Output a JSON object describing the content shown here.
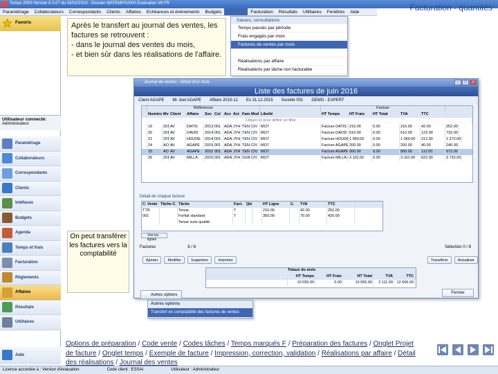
{
  "window": {
    "title": "Temps 2000 Version 8.3.07 du 03/02/2013 - Dossier MATEMPS2000 Evaluation V8 FR"
  },
  "slide_title": "Facturation - quantités",
  "menubar": [
    "Paramètrage",
    "Collaborateurs",
    "Correspondants",
    "Clients",
    "Affaires",
    "Echéances et événements",
    "Budgets",
    "",
    "Facturation",
    "Résultats",
    "Utilitaires",
    "Fenêtres",
    "Aide"
  ],
  "favorites": {
    "label": "Favoris"
  },
  "user": {
    "heading": "Utilisateur connecté:",
    "name": "Administrateur"
  },
  "nav": [
    {
      "label": "Paramètrage",
      "color": "#5b7fbf"
    },
    {
      "label": "Collaborateurs",
      "color": "#4a8ad8"
    },
    {
      "label": "Correspondants",
      "color": "#6aa0e0"
    },
    {
      "label": "Clients",
      "color": "#3c78c8"
    },
    {
      "label": "Intéfaces",
      "color": "#5a8f4a"
    },
    {
      "label": "Budgets",
      "color": "#8a5a2f"
    },
    {
      "label": "Agenda",
      "color": "#c45c3c"
    },
    {
      "label": "Temps et frais",
      "color": "#4c7fc0"
    },
    {
      "label": "Facturation",
      "color": "#7a8fb0"
    },
    {
      "label": "Règlements",
      "color": "#c08a30"
    },
    {
      "label": "Affaires",
      "color": "#d9a030",
      "active": true
    },
    {
      "label": "Résultats",
      "color": "#4f9a54"
    },
    {
      "label": "Utilitaires",
      "color": "#6e7fa0"
    }
  ],
  "bottom_nav": [
    {
      "label": "Aide",
      "color": "#3a78c8"
    },
    {
      "label": "",
      "color": "#4f9a54"
    }
  ],
  "callout1": [
    "Après le transfert au journal des ventes, les factures se retrouvent :",
    "- dans le journal des ventes du mois,",
    "- et bien sûr dans les réalisations de l'affaire."
  ],
  "dropdown": {
    "header": "Saisies, consultations",
    "items": [
      "Temps passés par période",
      "Frais engagés par mois",
      "Factures de ventes par mois",
      "",
      "Réalisations par affaire",
      "Réalisations par tâche non facturable"
    ],
    "selected_index": 2
  },
  "journal": {
    "title": "Journal de ventes - Détail d'un mois",
    "list_title": "Liste des factures de juin 2016",
    "filters": [
      "Client AGAPE",
      "Mr Joel AGAPE",
      "Affaire 2015-12",
      "Ex 31.12.2015",
      "Société 001",
      "DEMO - EXPERT"
    ],
    "group_headers": [
      "",
      "Références",
      "",
      "Facture"
    ],
    "columns": [
      "",
      "Numéro",
      "Mvt",
      "Client",
      "Affaire",
      "Soc",
      "Col",
      "Acc",
      "Act",
      "Fam",
      "Mod",
      "Libellé",
      "HT Temps",
      "HT Frais",
      "HT Total",
      "TVA",
      "TTC"
    ],
    "filter_hint": "Cliquer ici pour définir un filtre",
    "rows": [
      [
        "19",
        "2016003",
        "AV",
        "DATIS",
        "2013-12",
        "001",
        "ADA",
        "JYH",
        "TEN",
        "CIV",
        "MO7",
        "Facture DATIS du 15/03/2016",
        "215.00",
        "0.00",
        "210.00",
        "42.00",
        "252.00"
      ],
      [
        "20",
        "2016005",
        "AV",
        "DAVID",
        "2014-01",
        "001",
        "ADA",
        "JYH",
        "TEN",
        "CIV",
        "MO7",
        "Facture DAVID du 15/03/2016",
        "610.00",
        "0.00",
        "610.00",
        "122.00",
        "732.00"
      ],
      [
        "21",
        "2016006",
        "AV",
        "HOUDE",
        "2014-12",
        "001",
        "ADA",
        "JYH",
        "TEN",
        "CIV",
        "MO7",
        "Facture HOUDE du 15/03/2016",
        "1 060.00",
        "0.00",
        "1 060.00",
        "212.00",
        "1 272.00"
      ],
      [
        "24",
        "AOHEN31",
        "AV",
        "AGAPE",
        "2015-12",
        "001",
        "ADA",
        "JYH",
        "TEN",
        "CIV",
        "MO7",
        "Facture AGAPE du 25/06/2016",
        "200.00",
        "0.00",
        "200.00",
        "40.00",
        "240.00"
      ],
      [
        "25",
        "AOHEN32",
        "AV",
        "AGAPE",
        "2015-12",
        "001",
        "ADA",
        "JYH",
        "TEN",
        "CIV",
        "MO7",
        "Facture AGAPE du 25/06/2016",
        "560.00",
        "0.00",
        "560.00",
        "112.00",
        "672.00"
      ],
      [
        "26",
        "2016314",
        "AV",
        "MILLA",
        "2015-12",
        "001",
        "ADA",
        "JYH",
        "SUR",
        "CIV",
        "MO7",
        "Facture MILLA du 25/03/2016",
        "3 110.00",
        "0.00",
        "3 110.00",
        "622.00",
        "3 732.00"
      ]
    ],
    "selected_row": 4,
    "detail_header": "Détail de chaque facture",
    "detail_columns": [
      "C. Vente",
      "Tâche C.",
      "Tâche",
      "Fact.",
      "Qté",
      "",
      "HT Ligne",
      "C.",
      "TVA",
      "TTC"
    ],
    "detail_rows": [
      [
        "TTR",
        "",
        "Tenue",
        "T",
        "",
        "",
        "210.00",
        "",
        "42.00",
        "252.00"
      ],
      [
        "001",
        "",
        "Forfait standard",
        "T",
        "",
        "",
        "350.00",
        "",
        "70.00",
        "420.00"
      ],
      [
        "",
        "",
        "Tenue suivi qualité",
        "",
        "",
        "",
        "",
        "",
        "",
        ""
      ]
    ],
    "show_detail_btn": "Voir les lignes",
    "factures_label": "Factures",
    "factures_count": "8 / 8",
    "selection_label": "Sélection",
    "selection_count": "0 / 8",
    "toolbar": [
      "Ajouter",
      "Modifier",
      "Supprimer",
      "Imprimer",
      "",
      "Transférer",
      "Actualiser"
    ],
    "totals_header": "Totaux du mois",
    "totals_columns": [
      "",
      "HT Temps",
      "HT Frais",
      "HT Total",
      "TVA",
      "TTC"
    ],
    "totals_row": [
      "",
      "10 555.00",
      "0.00",
      "10 555.00",
      "2 111.00",
      "12 666.00"
    ],
    "close_btn": "Fermer"
  },
  "callout2": "On peut transférer les factures vers la comptabilité",
  "autres": {
    "button": "Autres options",
    "menu_header": "Autres options",
    "menu_item": "Transfert en comptabilité des factures de ventes"
  },
  "links": [
    "Options de préparation",
    "Code vente",
    "Codes tâches",
    "Temps marqués F",
    "Préparation des factures",
    "Onglet Projet de facture",
    "Onglet temps",
    "Exemple de facture",
    "Impression, correction, validation",
    "Réalisations par affaire",
    "Détail des réalisations",
    "Journal des ventes"
  ],
  "status": [
    "Licence accordée à : Version d'évaluation",
    "Code client : ESSAI",
    "Utilisateur : Administrateur"
  ]
}
